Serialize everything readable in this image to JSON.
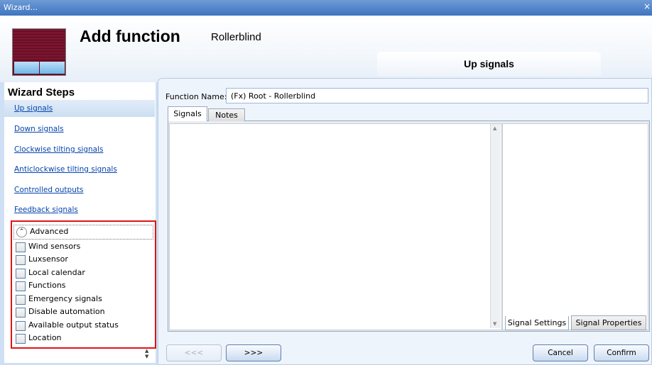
{
  "window": {
    "title": "Wizard...",
    "close_glyph": "×"
  },
  "header": {
    "title": "Add function",
    "subtitle": "Rollerblind",
    "current_step": "Up signals"
  },
  "sidebar": {
    "title": "Wizard Steps",
    "steps": [
      {
        "label": "Up signals",
        "selected": true
      },
      {
        "label": "Down signals"
      },
      {
        "label": "Clockwise tilting signals"
      },
      {
        "label": "Anticlockwise tilting signals"
      },
      {
        "label": "Controlled outputs"
      },
      {
        "label": "Feedback signals"
      }
    ],
    "advanced": {
      "label": "Advanced",
      "items": [
        {
          "label": "Wind sensors",
          "checked": false
        },
        {
          "label": "Luxsensor",
          "checked": false
        },
        {
          "label": "Local calendar",
          "checked": false
        },
        {
          "label": "Functions",
          "checked": false
        },
        {
          "label": "Emergency signals",
          "checked": false
        },
        {
          "label": "Disable automation",
          "checked": false
        },
        {
          "label": "Available output status",
          "checked": false
        },
        {
          "label": "Location",
          "checked": false
        }
      ]
    }
  },
  "main": {
    "function_name_label": "Function Name:",
    "function_name_value": "(Fx) Root - Rollerblind",
    "tabs": [
      {
        "label": "Signals",
        "active": true
      },
      {
        "label": "Notes",
        "active": false
      }
    ],
    "property_tabs": [
      {
        "label": "Signal Settings",
        "active": true
      },
      {
        "label": "Signal Properties",
        "active": false
      }
    ]
  },
  "footer": {
    "prev_label": "<<<",
    "next_label": ">>>",
    "cancel_label": "Cancel",
    "confirm_label": "Confirm"
  },
  "colors": {
    "highlight_border": "#e31313",
    "link": "#0645ad",
    "title_bar": "#4f82c6"
  }
}
